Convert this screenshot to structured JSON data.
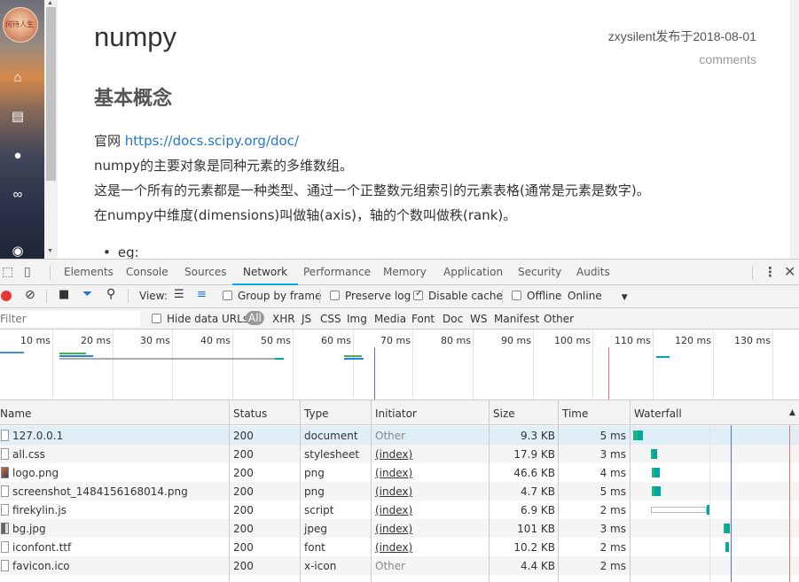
{
  "page": {
    "title": "numpy",
    "author_line": "zxysilent发布于2018-08-01",
    "comments": "comments",
    "heading": "基本概念",
    "official_label": "官网",
    "official_link": "https://docs.scipy.org/doc/",
    "line2": "numpy的主要对象是同种元素的多维数组。",
    "line3": "这是一个所有的元素都是一种类型、通过一个正整数元组索引的元素表格(通常是元素是数字)。",
    "line4": "在numpy中维度(dimensions)叫做轴(axis)，轴的个数叫做秩(rank)。",
    "bullet": "eg:",
    "avatar_text": "何待人生"
  },
  "leftbar_icons": [
    "home-icon",
    "archive-icon",
    "user-icon",
    "link-icon",
    "github-icon"
  ],
  "devtools": {
    "tabs": [
      "Elements",
      "Console",
      "Sources",
      "Network",
      "Performance",
      "Memory",
      "Application",
      "Security",
      "Audits"
    ],
    "active_tab": "Network",
    "toolbar": {
      "view_label": "View:",
      "group_by_frame": "Group by frame",
      "preserve_log": "Preserve log",
      "disable_cache": "Disable cache",
      "offline": "Offline",
      "throttle": "Online"
    },
    "filter": {
      "placeholder": "Filter",
      "hide_data_urls": "Hide data URLs",
      "types": [
        "All",
        "XHR",
        "JS",
        "CSS",
        "Img",
        "Media",
        "Font",
        "Doc",
        "WS",
        "Manifest",
        "Other"
      ]
    },
    "overview_ticks": [
      "10 ms",
      "20 ms",
      "30 ms",
      "40 ms",
      "50 ms",
      "60 ms",
      "70 ms",
      "80 ms",
      "90 ms",
      "100 ms",
      "110 ms",
      "120 ms",
      "130 ms"
    ],
    "columns": [
      "Name",
      "Status",
      "Type",
      "Initiator",
      "Size",
      "Time",
      "Waterfall"
    ],
    "rows": [
      {
        "name": "127.0.0.1",
        "status": "200",
        "type": "document",
        "initiator": "Other",
        "size": "9.3 KB",
        "time": "5 ms"
      },
      {
        "name": "all.css",
        "status": "200",
        "type": "stylesheet",
        "initiator": "(index)",
        "size": "17.9 KB",
        "time": "3 ms"
      },
      {
        "name": "logo.png",
        "status": "200",
        "type": "png",
        "initiator": "(index)",
        "size": "46.6 KB",
        "time": "4 ms"
      },
      {
        "name": "screenshot_1484156168014.png",
        "status": "200",
        "type": "png",
        "initiator": "(index)",
        "size": "4.7 KB",
        "time": "5 ms"
      },
      {
        "name": "firekylin.js",
        "status": "200",
        "type": "script",
        "initiator": "(index)",
        "size": "6.9 KB",
        "time": "2 ms"
      },
      {
        "name": "bg.jpg",
        "status": "200",
        "type": "jpeg",
        "initiator": "(index)",
        "size": "101 KB",
        "time": "3 ms"
      },
      {
        "name": "iconfont.ttf",
        "status": "200",
        "type": "font",
        "initiator": "(index)",
        "size": "10.2 KB",
        "time": "2 ms"
      },
      {
        "name": "favicon.ico",
        "status": "200",
        "type": "x-icon",
        "initiator": "Other",
        "size": "4.4 KB",
        "time": "2 ms"
      }
    ]
  },
  "colors": {
    "link": "#2479cc",
    "active_tab_underline": "#03a9f4",
    "record": "#e53935",
    "waterfall_waiting": "#00a6a0",
    "dom_content_loaded": "#5b6ee1",
    "load_event": "#e57373"
  }
}
